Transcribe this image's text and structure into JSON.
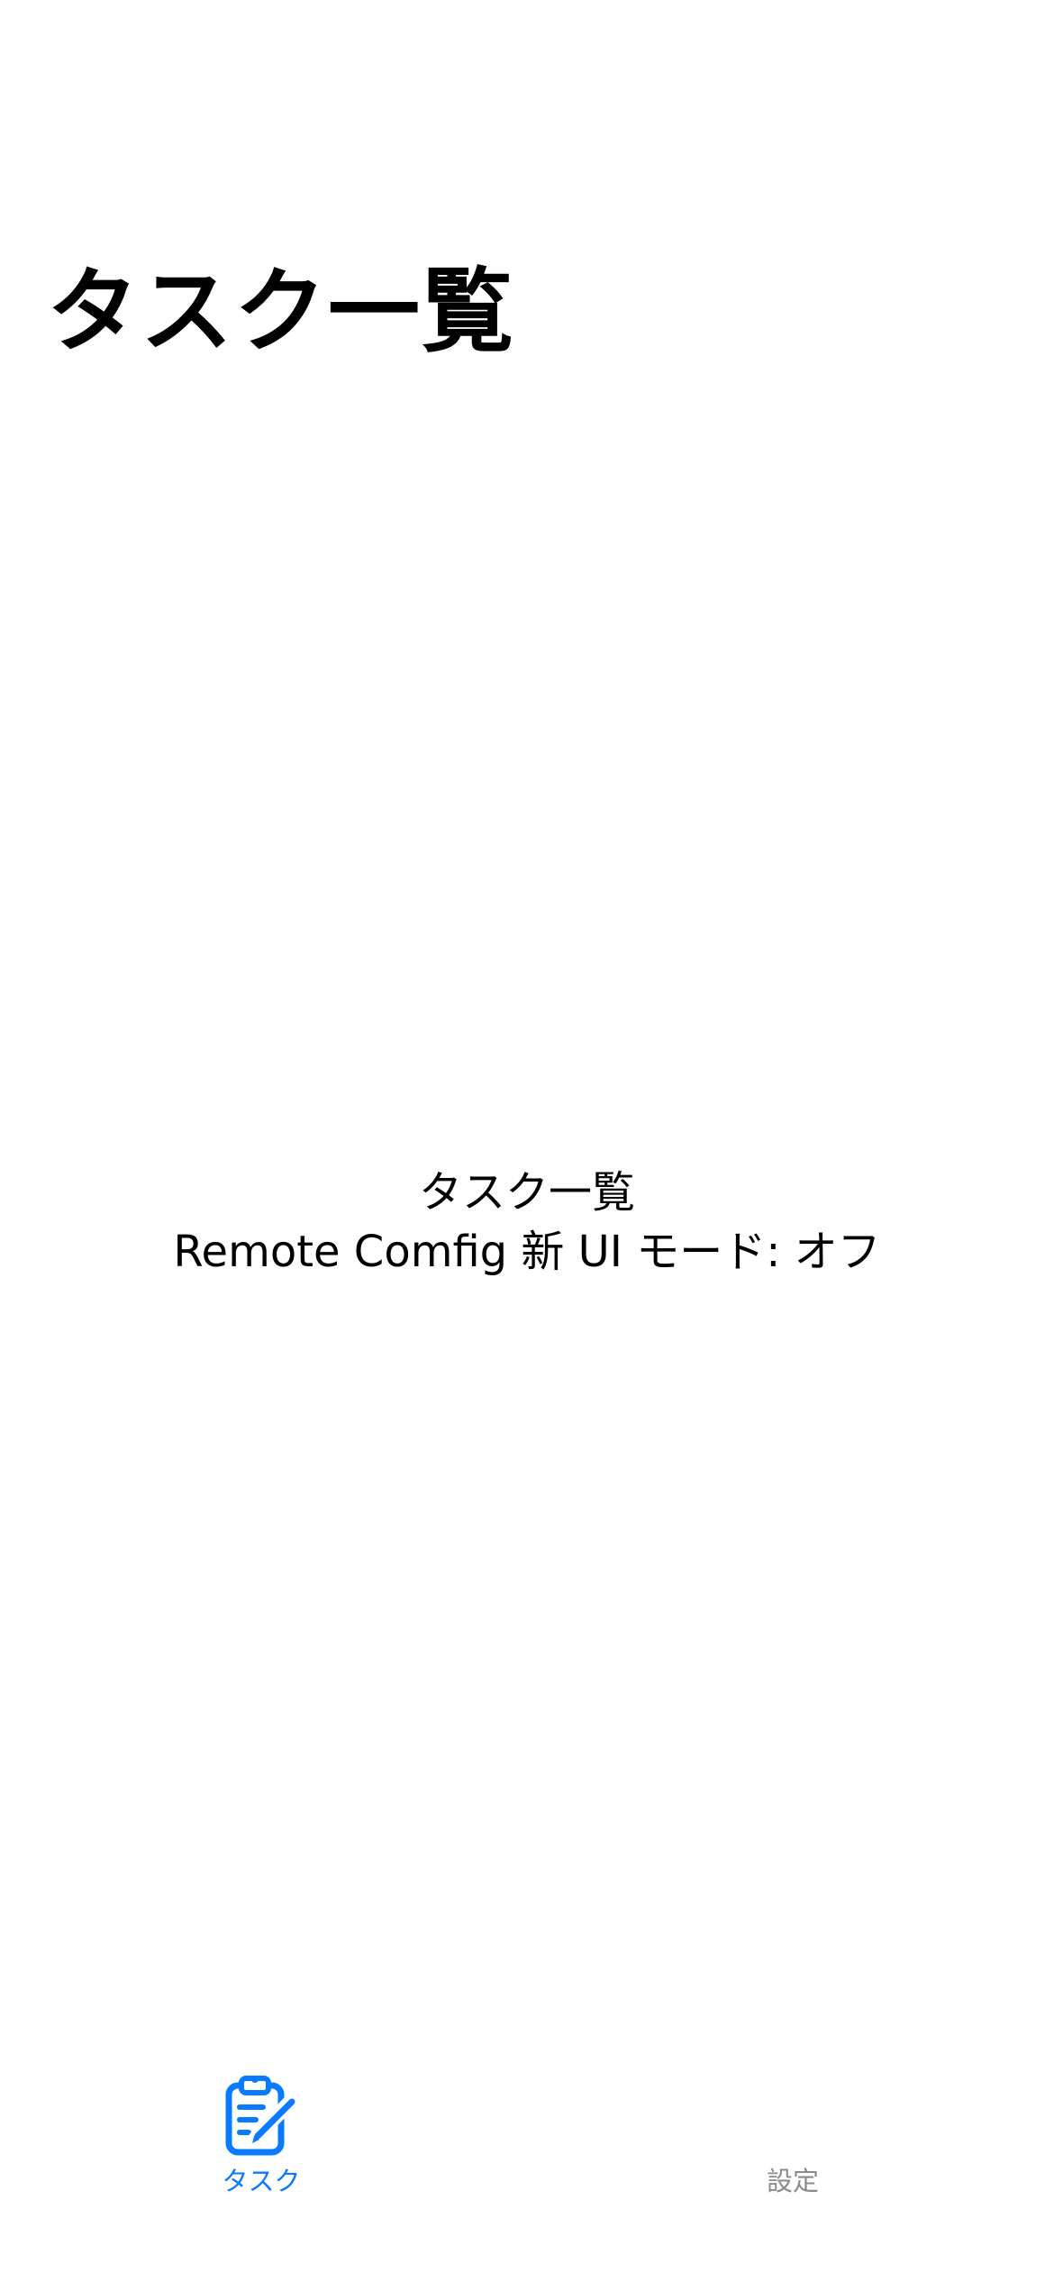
{
  "header": {
    "title": "タスク一覧"
  },
  "main": {
    "heading": "タスク一覧",
    "status_text": "Remote Comfig 新 UI モード: オフ"
  },
  "tab_bar": {
    "tabs": [
      {
        "label": "タスク",
        "icon": "clipboard-edit-icon",
        "selected": true
      },
      {
        "label": "設定",
        "icon": "",
        "selected": false
      }
    ]
  },
  "colors": {
    "accent": "#0a7aff",
    "inactive": "#8a8a8e",
    "background": "#ffffff",
    "text": "#000000"
  }
}
